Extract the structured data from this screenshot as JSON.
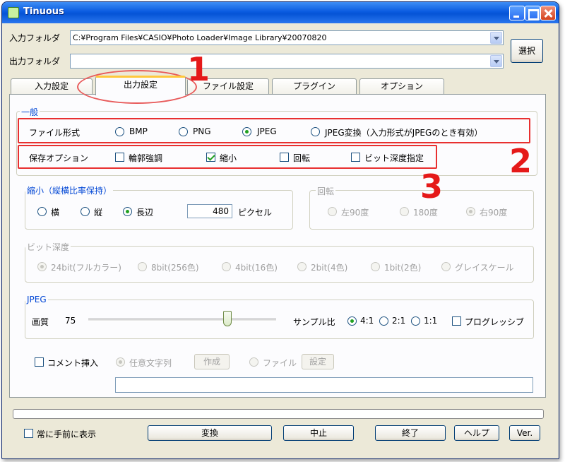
{
  "window": {
    "title": "Tinuous"
  },
  "input": {
    "label": "入力フォルダ",
    "value": "C:¥Program Files¥CASIO¥Photo Loader¥Image Library¥20070820"
  },
  "output": {
    "label": "出力フォルダ",
    "value": ""
  },
  "select_button": "選択",
  "tabs": [
    "入力設定",
    "出力設定",
    "ファイル設定",
    "プラグイン",
    "オプション"
  ],
  "general": {
    "legend": "一般",
    "file_format_label": "ファイル形式",
    "formats": [
      "BMP",
      "PNG",
      "JPEG",
      "JPEG変換（入力形式がJPEGのとき有効）"
    ],
    "selected_format": "JPEG",
    "save_options_label": "保存オプション",
    "save_options": [
      {
        "label": "輪郭強調",
        "checked": false
      },
      {
        "label": "縮小",
        "checked": true
      },
      {
        "label": "回転",
        "checked": false
      },
      {
        "label": "ビット深度指定",
        "checked": false
      }
    ]
  },
  "shrink": {
    "legend": "縮小（縦横比率保持）",
    "options": [
      "横",
      "縦",
      "長辺"
    ],
    "selected": "長辺",
    "value": "480",
    "unit": "ピクセル"
  },
  "rotate": {
    "legend": "回転",
    "options": [
      "左90度",
      "180度",
      "右90度"
    ],
    "selected": "右90度"
  },
  "bitdepth": {
    "legend": "ビット深度",
    "options": [
      "24bit(フルカラー)",
      "8bit(256色)",
      "4bit(16色)",
      "2bit(4色)",
      "1bit(2色)",
      "グレイスケール"
    ],
    "selected": "24bit(フルカラー)"
  },
  "jpeg": {
    "legend": "JPEG",
    "quality_label": "画質",
    "quality_value": "75",
    "quality_fraction": 0.75,
    "sampling_label": "サンプル比",
    "sampling_options": [
      "4:1",
      "2:1",
      "1:1"
    ],
    "sampling_selected": "4:1",
    "progressive_label": "プログレッシブ",
    "progressive_checked": false
  },
  "comment": {
    "checkbox_label": "コメント挿入",
    "checked": false,
    "option_text": "任意文字列",
    "create_button": "作成",
    "option_file": "ファイル",
    "setting_button": "設定",
    "value": ""
  },
  "footer": {
    "always_on_top": "常に手前に表示",
    "convert": "変換",
    "stop": "中止",
    "exit": "終了",
    "help": "ヘルプ",
    "version": "Ver."
  },
  "annotations": [
    "1",
    "2",
    "3"
  ],
  "colors": {
    "annotation_red": "#e51919",
    "titlebar_blue": "#0a5be0",
    "legend_blue": "#0046d5",
    "radio_green": "#21a121"
  }
}
